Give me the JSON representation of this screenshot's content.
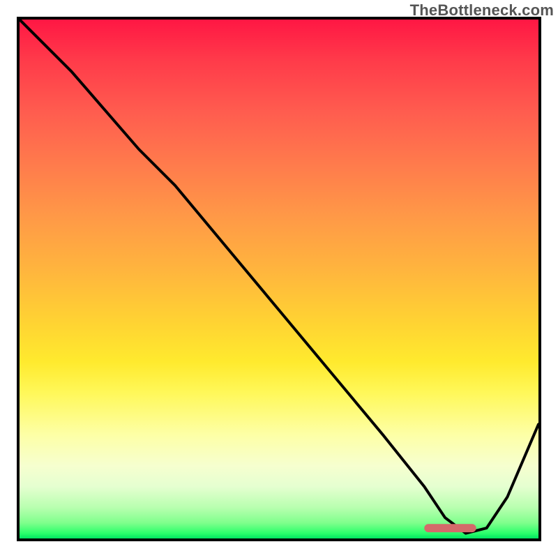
{
  "watermark": "TheBottleneck.com",
  "chart_data": {
    "type": "line",
    "title": "",
    "xlabel": "",
    "ylabel": "",
    "xlim": [
      0,
      100
    ],
    "ylim": [
      0,
      100
    ],
    "grid": false,
    "legend": false,
    "series": [
      {
        "name": "bottleneck-curve",
        "x": [
          0,
          10,
          23,
          30,
          40,
          50,
          60,
          70,
          78,
          82,
          86,
          90,
          94,
          100
        ],
        "y": [
          100,
          90,
          75,
          68,
          56,
          44,
          32,
          20,
          10,
          4,
          1,
          2,
          8,
          22
        ],
        "stroke": "#000000",
        "stroke_width": 4
      }
    ],
    "marker": {
      "name": "optimal-range-marker",
      "x0": 78,
      "x1": 88,
      "y": 2,
      "color": "#d46a6a",
      "height_pct": 1.6
    },
    "background_gradient_stops": [
      {
        "pct": 0,
        "color": "#ff1744"
      },
      {
        "pct": 50,
        "color": "#ffc233"
      },
      {
        "pct": 78,
        "color": "#fcff66"
      },
      {
        "pct": 90,
        "color": "#e8ffcc"
      },
      {
        "pct": 100,
        "color": "#00e461"
      }
    ]
  }
}
